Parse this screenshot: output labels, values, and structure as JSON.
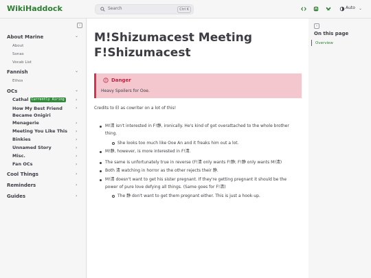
{
  "header": {
    "logo": "WikiHaddock",
    "search_placeholder": "Search",
    "search_shortcut": "Ctrl K",
    "appearance_label": "Auto"
  },
  "sidebar": {
    "sections": [
      {
        "label": "About Marine",
        "items": [
          "About",
          "Sonas",
          "Vocab List"
        ]
      },
      {
        "label": "Fannish",
        "items": [
          "Ethos"
        ]
      },
      {
        "label": "OCs"
      },
      {
        "label": "Cool Things"
      },
      {
        "label": "Reminders"
      },
      {
        "label": "Guides"
      }
    ],
    "ocs": [
      {
        "label": "Cathal",
        "badge": "Currently Airing"
      },
      {
        "label": "How My Best Friend Became Onigiri"
      },
      {
        "label": "Menagerie"
      },
      {
        "label": "Meeting You Like This"
      },
      {
        "label": "Binkies"
      },
      {
        "label": "Unnamed Story"
      },
      {
        "label": "Misc."
      },
      {
        "label": "Fan OCs"
      }
    ]
  },
  "main": {
    "title": "M!Shizumacest Meeting F!Shizumacest",
    "danger_title": "Danger",
    "danger_text": "Heavy Spoilers for Ooe.",
    "credits": "Credits to El as cowriter on a lot of this!",
    "bullets": [
      "M!清 isn't interested in F!静, ironically. He's kind of got overattached to the whole brother thing.",
      "She looks too much like Ooe An and it freaks him out a lot.",
      "M!静, however, is more interested in F!清.",
      "The same is unfortunately true in reverse (F!清 only wants F!静; F!静 only wants M!清)",
      "Both 清 watching in horror as the other rejects their 静.",
      "M!清 doesn't want to get his sister pregnant. If they're getting pregnant it should be the power of pure love defying all things. (Same goes for F!清)",
      "The 静 don't want to get them pregnant either. This is just a hook-up."
    ]
  },
  "toc": {
    "title": "On this page",
    "items": [
      "Overview"
    ]
  },
  "colors": {
    "accent": "#2e7d32",
    "danger": "#d9304f",
    "danger_bg": "#f4c7cf"
  }
}
